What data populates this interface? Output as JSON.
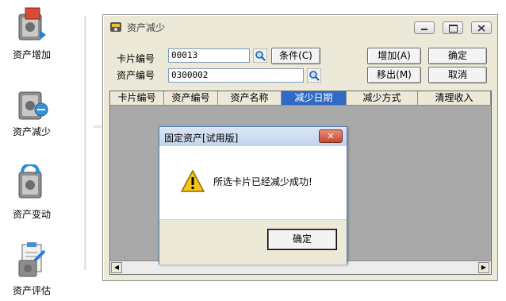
{
  "launcher": {
    "items": [
      {
        "label": "资产增加",
        "icon": "asset-add-icon"
      },
      {
        "label": "资产减少",
        "icon": "asset-reduce-icon"
      },
      {
        "label": "资产变动",
        "icon": "asset-change-icon"
      },
      {
        "label": "资产评估",
        "icon": "asset-evaluate-icon"
      }
    ]
  },
  "window": {
    "title": "资产减少",
    "fields": {
      "card_no_label": "卡片编号",
      "card_no_value": "00013",
      "asset_no_label": "资产编号",
      "asset_no_value": "0300002"
    },
    "buttons": {
      "condition": "条件(C)",
      "add": "增加(A)",
      "remove": "移出(M)",
      "confirm": "确定",
      "cancel": "取消"
    },
    "columns": [
      "卡片编号",
      "资产编号",
      "资产名称",
      "减少日期",
      "减少方式",
      "清理收入"
    ],
    "selected_column": "减少日期"
  },
  "dialog": {
    "title": "固定资产[试用版]",
    "message": "所选卡片已经减少成功!",
    "ok": "确定"
  },
  "colors": {
    "window_bg": "#ece9d8",
    "selected_header": "#3169c6",
    "grid_bg": "#a9a9a9"
  }
}
